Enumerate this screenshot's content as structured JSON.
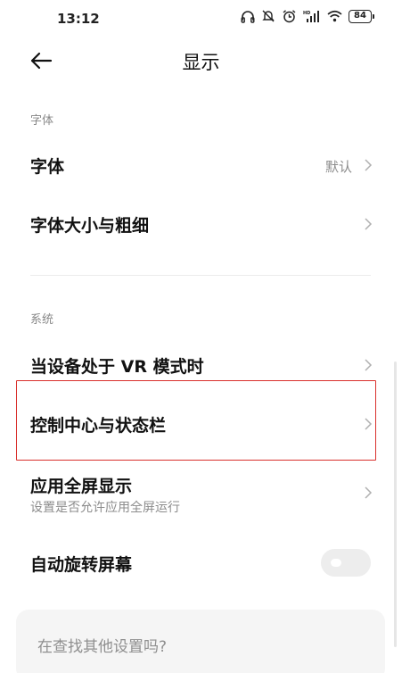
{
  "status_bar": {
    "time": "13:12",
    "icons": [
      "headphones-icon",
      "mute-bell-icon",
      "alarm-icon",
      "hd-signal-icon",
      "wifi-icon",
      "battery-icon"
    ],
    "battery_level": "84"
  },
  "header": {
    "back_icon": "arrow-left-icon",
    "title": "显示"
  },
  "sections": {
    "font": {
      "label": "字体",
      "items": [
        {
          "title": "字体",
          "value": "默认"
        },
        {
          "title": "字体大小与粗细"
        }
      ]
    },
    "system": {
      "label": "系统",
      "items": [
        {
          "title": "当设备处于 VR 模式时"
        },
        {
          "title": "控制中心与状态栏",
          "highlighted": true
        },
        {
          "title": "应用全屏显示",
          "subtitle": "设置是否允许应用全屏运行"
        },
        {
          "title": "自动旋转屏幕",
          "toggle_on": false
        }
      ]
    }
  },
  "search_card": {
    "text": "在查找其他设置吗?"
  },
  "colors": {
    "highlight": "#d9302c",
    "secondary_text": "#8c8c8c",
    "card_bg": "#f5f5f5"
  }
}
